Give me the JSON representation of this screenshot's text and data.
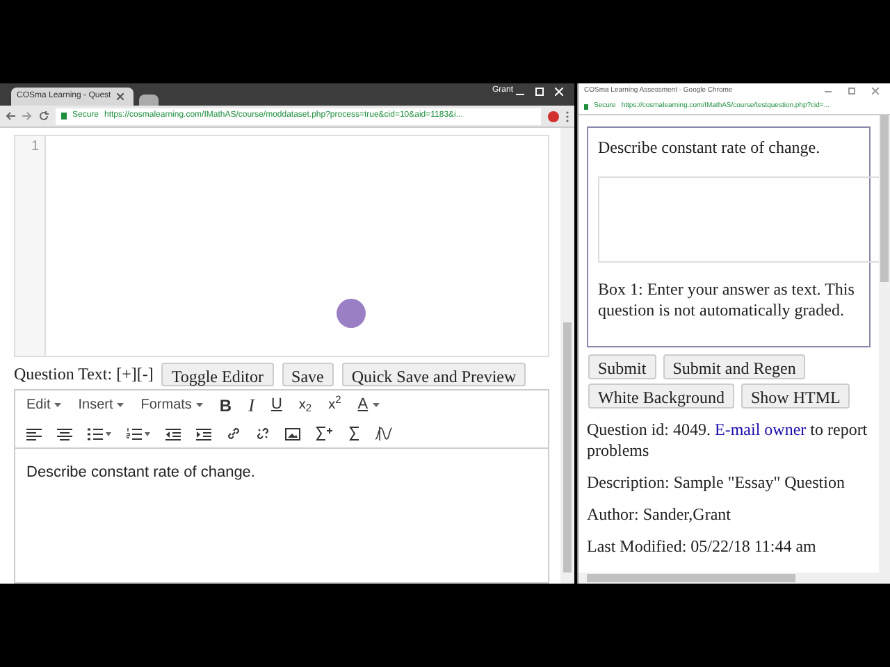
{
  "left_window": {
    "tab_title": "COSma Learning - Quest",
    "user": "Grant",
    "address": {
      "secure": "Secure",
      "url": "https://cosmalearning.com/IMathAS/course/moddataset.php?process=true&cid=10&aid=1183&i..."
    },
    "code_editor": {
      "line_numbers": [
        "1"
      ]
    },
    "question_text": {
      "label": "Question Text: [+][-]",
      "buttons": [
        "Toggle Editor",
        "Save",
        "Quick Save and Preview"
      ]
    },
    "menus": [
      "Edit",
      "Insert",
      "Formats"
    ],
    "toolbar_row1": [
      {
        "kind": "bold",
        "text": "B"
      },
      {
        "kind": "italic",
        "text": "I"
      },
      {
        "kind": "underline",
        "text": "U"
      },
      {
        "kind": "subscript",
        "text": "x$_{2}$"
      },
      {
        "kind": "superscript",
        "text": "x$^{2}$"
      },
      {
        "kind": "color",
        "text": "A"
      }
    ],
    "editor_text": "Describe constant rate of change."
  },
  "right_window": {
    "title": "COSma Learning Assessment - Google Chrome",
    "address": {
      "secure": "Secure",
      "url": "https://cosmalearning.com/IMathAS/course/testquestion.php?cid=..."
    },
    "question": "Describe constant rate of change.",
    "box_note": "Box 1: Enter your answer as text. This question is not automatically graded.",
    "buttons": [
      "Submit",
      "Submit and Regen",
      "White Background",
      "Show HTML"
    ],
    "info": {
      "prefix": "Question id: 4049.",
      "link": "E-mail owner",
      "suffix": "to report problems"
    },
    "lines": [
      "Description: Sample \"Essay\" Question",
      "Author: Sander,Grant",
      "Last Modified: 05/22/18 11:44 am"
    ]
  }
}
